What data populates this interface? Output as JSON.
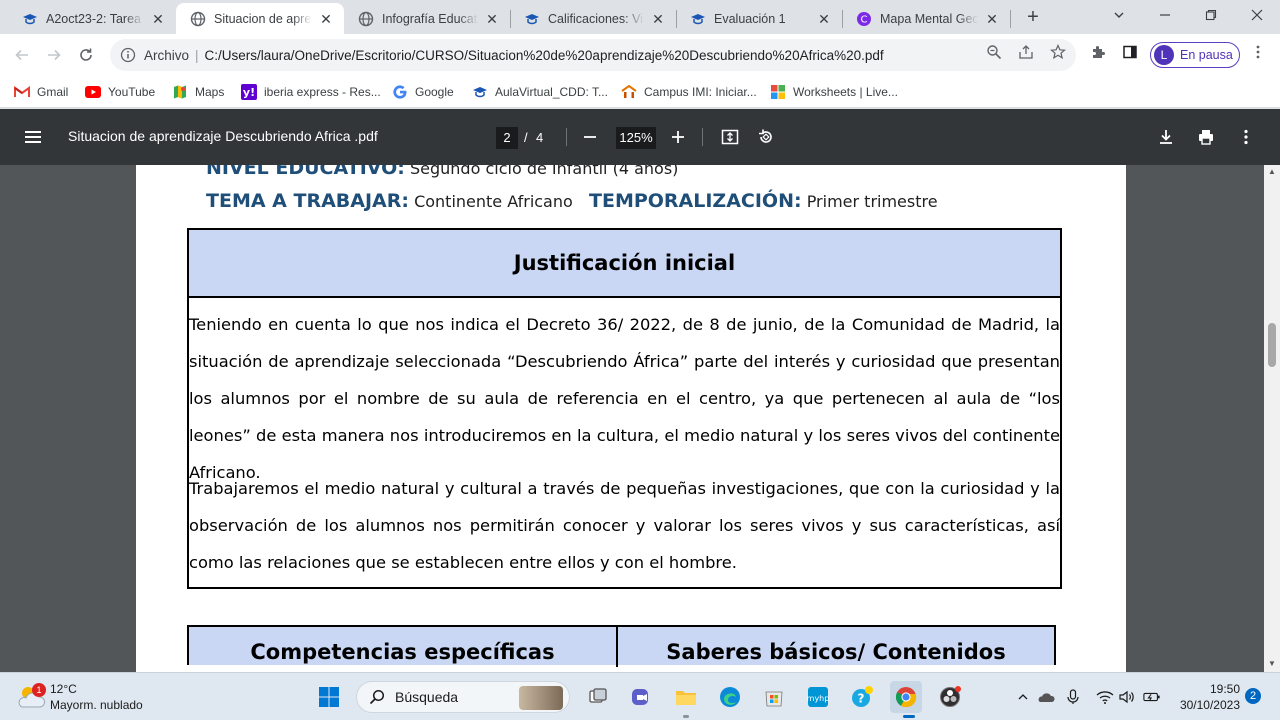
{
  "browser": {
    "tabs": [
      {
        "title": "A2oct23-2: Tarea p",
        "icon": "moodle-cap-icon",
        "active": false
      },
      {
        "title": "Situacion de aprend",
        "icon": "globe-icon",
        "active": true
      },
      {
        "title": "Infografía Educativ",
        "icon": "globe-icon",
        "active": false
      },
      {
        "title": "Calificaciones: Vist",
        "icon": "moodle-cap-icon",
        "active": false
      },
      {
        "title": "Evaluación 1",
        "icon": "moodle-cap-icon",
        "active": false
      },
      {
        "title": "Mapa Mental Geo",
        "icon": "canva-icon",
        "active": false
      }
    ],
    "address": {
      "scheme": "Archivo",
      "url": "C:/Users/laura/OneDrive/Escritorio/CURSO/Situacion%20de%20aprendizaje%20Descubriendo%20Africa%20.pdf"
    },
    "profile": {
      "initial": "L",
      "label": "En pausa"
    },
    "bookmarks": [
      {
        "label": "Gmail",
        "icon": "gmail-icon"
      },
      {
        "label": "YouTube",
        "icon": "youtube-icon"
      },
      {
        "label": "Maps",
        "icon": "maps-icon"
      },
      {
        "label": "iberia express - Res...",
        "icon": "yahoo-icon"
      },
      {
        "label": "Google",
        "icon": "google-icon"
      },
      {
        "label": "AulaVirtual_CDD: T...",
        "icon": "moodle-cap-icon"
      },
      {
        "label": "Campus IMI: Iniciar...",
        "icon": "campus-icon"
      },
      {
        "label": "Worksheets | Live...",
        "icon": "worksheets-icon"
      }
    ]
  },
  "pdf": {
    "title": "Situacion de aprendizaje Descubriendo Africa .pdf",
    "current_page": "2",
    "page_sep": "/",
    "total_pages": "4",
    "zoom": "125%"
  },
  "document": {
    "nivel_key": "NIVEL EDUCATIVO:",
    "nivel_value": "Segundo ciclo de Infantil (4 años)",
    "tema_key": "TEMA A TRABAJAR:",
    "tema_value": "Continente Africano",
    "temp_key": "TEMPORALIZACIÓN:",
    "temp_value": "Primer trimestre",
    "section_title": "Justificación inicial",
    "paragraph1": "Teniendo en cuenta lo que nos indica el Decreto 36/ 2022, de 8 de junio, de la Comunidad de Madrid, la situación de aprendizaje seleccionada “Descubriendo África” parte del interés y curiosidad que presentan los alumnos por el nombre de su aula de referencia en el centro, ya que pertenecen al aula de “los leones” de esta manera nos introduciremos en la cultura, el medio natural y los seres vivos del continente Africano.",
    "paragraph2": "Trabajaremos el medio natural y cultural a través de pequeñas investigaciones, que con la curiosidad y la observación de los alumnos nos permitirán conocer y valorar los seres vivos y sus características, así como las relaciones que se establecen entre ellos y con el hombre.",
    "table2_col1": "Competencias específicas",
    "table2_col2": "Saberes básicos/ Contenidos"
  },
  "taskbar": {
    "weather_badge": "1",
    "temperature": "12°C",
    "condition": "Mayorm. nublado",
    "search_label": "Búsqueda",
    "time": "19:50",
    "date": "30/10/2023",
    "notifications": "2"
  }
}
